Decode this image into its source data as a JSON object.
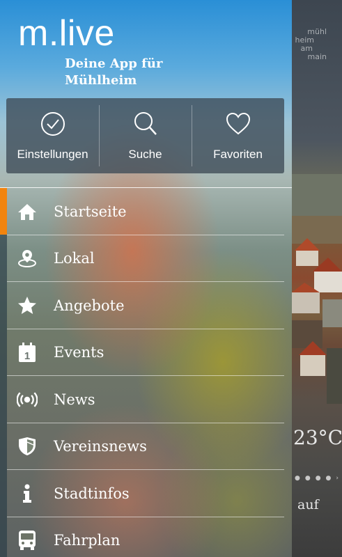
{
  "app": {
    "logo": "m.live",
    "tagline_line1": "Deine App für",
    "tagline_line2": "Mühlheim"
  },
  "quickbar": [
    {
      "label": "Einstellungen",
      "icon": "check-circle-icon"
    },
    {
      "label": "Suche",
      "icon": "search-icon"
    },
    {
      "label": "Favoriten",
      "icon": "heart-icon"
    }
  ],
  "menu": {
    "active": "Startseite",
    "items": [
      {
        "label": "Startseite",
        "icon": "home-icon"
      },
      {
        "label": "Lokal",
        "icon": "location-pin-icon"
      },
      {
        "label": "Angebote",
        "icon": "star-icon"
      },
      {
        "label": "Events",
        "icon": "calendar-icon",
        "icon_text": "1"
      },
      {
        "label": "News",
        "icon": "broadcast-icon"
      },
      {
        "label": "Vereinsnews",
        "icon": "shield-icon"
      },
      {
        "label": "Stadtinfos",
        "icon": "info-icon"
      },
      {
        "label": "Fahrplan",
        "icon": "bus-icon"
      }
    ]
  },
  "background": {
    "logo_lines": [
      "mühl",
      "heim",
      "am",
      "main"
    ],
    "temperature": "23°C",
    "partial_text": "auf"
  },
  "colors": {
    "accent": "#f2840e",
    "header_sky": "#2a8fd6"
  }
}
